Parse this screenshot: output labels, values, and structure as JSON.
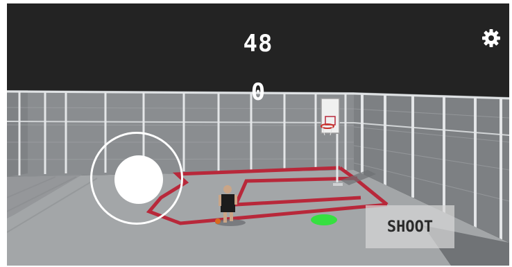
{
  "hud": {
    "timer": "48",
    "score": "0"
  },
  "controls": {
    "shoot_label": "SHOOT"
  },
  "icons": {
    "settings": "gear-icon",
    "joystick": "virtual-joystick",
    "target": "target-marker"
  },
  "colors": {
    "sky": "#232323",
    "court": "#a3a6a8",
    "court_line": "#b8283a",
    "target": "#36e040",
    "ui_white": "#ffffff",
    "shirt": "#1c1c1c"
  }
}
